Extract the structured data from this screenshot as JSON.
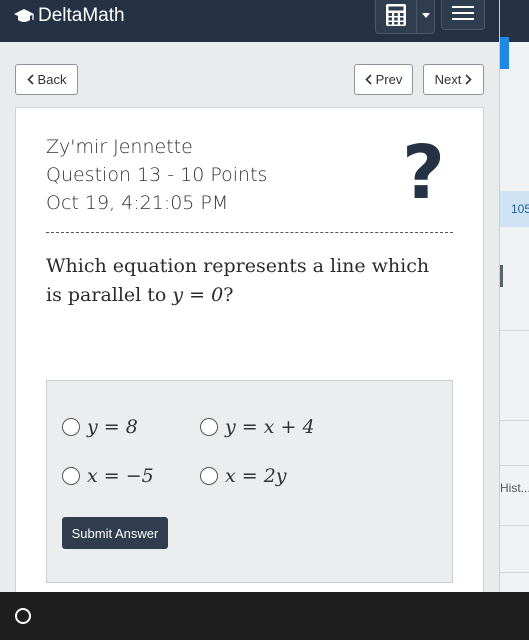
{
  "brand": {
    "name": "DeltaMath"
  },
  "nav": {
    "back": "Back",
    "prev": "Prev",
    "next": "Next"
  },
  "question": {
    "student": "Zy'mir Jennette",
    "title": "Question 13 - 10 Points",
    "timestamp": "Oct 19, 4:21:05 PM",
    "prompt_pre": "Which equation represents a line which is parallel to ",
    "prompt_math": "y = 0",
    "prompt_post": "?",
    "badge": "?"
  },
  "choices": [
    {
      "label": "y = 8"
    },
    {
      "label": "y = x + 4"
    },
    {
      "label": "x = −5"
    },
    {
      "label": "x = 2y"
    }
  ],
  "submit_label": "Submit Answer",
  "background": {
    "score_fragment": "105",
    "history_fragment": "Hist..."
  },
  "colors": {
    "navbar": "#243243",
    "accent": "#1e88e5",
    "button": "#2f3d4e"
  }
}
